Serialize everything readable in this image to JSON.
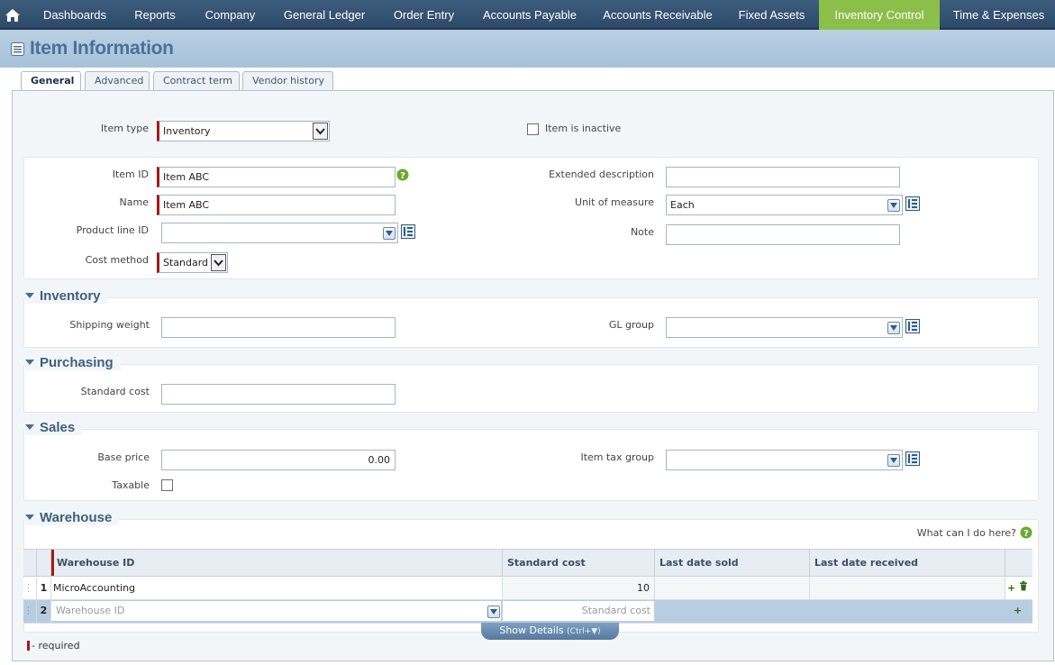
{
  "nav": {
    "items": [
      {
        "label": "Dashboards"
      },
      {
        "label": "Reports"
      },
      {
        "label": "Company"
      },
      {
        "label": "General Ledger"
      },
      {
        "label": "Order Entry"
      },
      {
        "label": "Accounts Payable"
      },
      {
        "label": "Accounts Receivable"
      },
      {
        "label": "Fixed Assets"
      },
      {
        "label": "Inventory Control"
      },
      {
        "label": "Time & Expenses"
      }
    ],
    "active": "Inventory Control",
    "active_color": "#8cbf4a"
  },
  "page": {
    "title": "Item Information"
  },
  "tabs": [
    {
      "label": "General"
    },
    {
      "label": "Advanced"
    },
    {
      "label": "Contract term"
    },
    {
      "label": "Vendor history"
    }
  ],
  "active_tab": "General",
  "form": {
    "item_type": {
      "label": "Item type",
      "value": "Inventory"
    },
    "inactive": {
      "label": "Item is inactive",
      "checked": false
    },
    "item_id": {
      "label": "Item ID",
      "value": "Item ABC"
    },
    "name": {
      "label": "Name",
      "value": "Item ABC"
    },
    "product_line": {
      "label": "Product line ID",
      "value": ""
    },
    "cost_method": {
      "label": "Cost method",
      "value": "Standard"
    },
    "extended_description": {
      "label": "Extended description",
      "value": ""
    },
    "unit_of_measure": {
      "label": "Unit of measure",
      "value": "Each"
    },
    "note": {
      "label": "Note",
      "value": ""
    }
  },
  "sections": {
    "inventory": {
      "title": "Inventory",
      "shipping_weight": {
        "label": "Shipping weight",
        "value": ""
      },
      "gl_group": {
        "label": "GL group",
        "value": ""
      }
    },
    "purchasing": {
      "title": "Purchasing",
      "standard_cost": {
        "label": "Standard cost",
        "value": ""
      }
    },
    "sales": {
      "title": "Sales",
      "base_price": {
        "label": "Base price",
        "value": "0.00"
      },
      "item_tax_group": {
        "label": "Item tax group",
        "value": ""
      },
      "taxable": {
        "label": "Taxable",
        "checked": false
      }
    },
    "warehouse": {
      "title": "Warehouse",
      "help": "What can I do here?",
      "columns": [
        "Warehouse ID",
        "Standard cost",
        "Last date sold",
        "Last date received"
      ],
      "rows": [
        {
          "num": "1",
          "warehouse_id": "MicroAccounting",
          "standard_cost": "10",
          "last_sold": "",
          "last_received": ""
        }
      ],
      "new_row": {
        "num": "2",
        "warehouse_placeholder": "Warehouse ID",
        "cost_placeholder": "Standard cost"
      },
      "show_details": "Show Details",
      "show_details_key": "(Ctrl+▼)"
    }
  },
  "footer": {
    "required_legend": "- required"
  },
  "colors": {
    "accent": "#4a7197",
    "required": "#a11a1a",
    "help": "#6aaa2a"
  }
}
